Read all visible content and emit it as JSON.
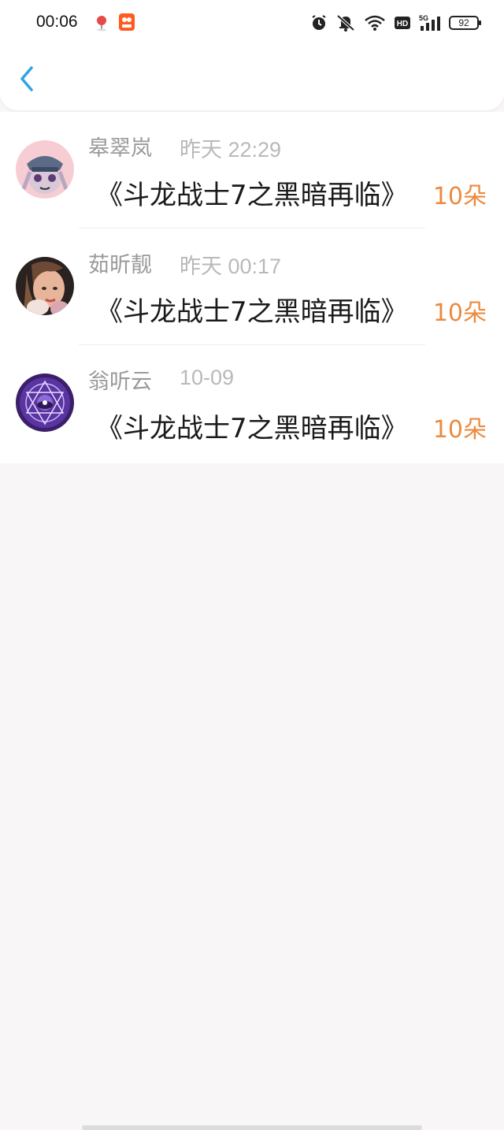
{
  "status_bar": {
    "time": "00:06",
    "battery": "92",
    "network": "5G",
    "hd_label": "HD",
    "icons": [
      "location-pin-icon",
      "app-notification-icon",
      "alarm-icon",
      "bell-muted-icon",
      "wifi-icon",
      "hd-icon",
      "signal-5g-icon",
      "battery-icon"
    ]
  },
  "header": {
    "back_icon": "chevron-left-icon",
    "accent_color": "#2fa4e7"
  },
  "colors": {
    "gift_count": "#ec8a3f",
    "name": "#9a9a9a",
    "timestamp": "#b9b9b9"
  },
  "items": [
    {
      "name": "皋翠岚",
      "time": "昨天 22:29",
      "title": "《斗龙战士7之黑暗再临》",
      "gift": "10朵"
    },
    {
      "name": "茹昕靓",
      "time": "昨天 00:17",
      "title": "《斗龙战士7之黑暗再临》",
      "gift": "10朵"
    },
    {
      "name": "翁听云",
      "time": "10-09",
      "title": "《斗龙战士7之黑暗再临》",
      "gift": "10朵"
    }
  ]
}
